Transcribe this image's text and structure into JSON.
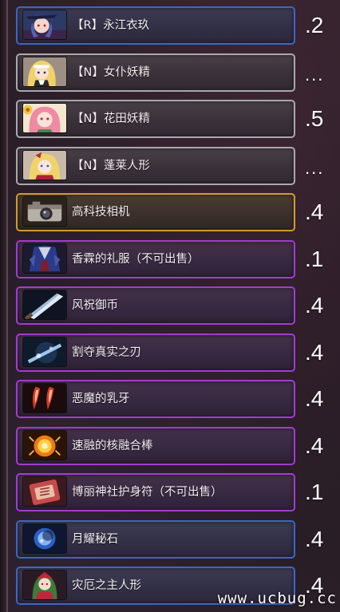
{
  "items": [
    {
      "label": "【R】永江衣玖",
      "value": ".2",
      "rarity": "blue",
      "icon": "character-portrait-icon"
    },
    {
      "label": "【N】女仆妖精",
      "value": "...",
      "rarity": "gray",
      "icon": "character-portrait-icon"
    },
    {
      "label": "【N】花田妖精",
      "value": ".5",
      "rarity": "gray",
      "icon": "character-portrait-icon"
    },
    {
      "label": "【N】蓬莱人形",
      "value": "...",
      "rarity": "gray",
      "icon": "character-portrait-icon"
    },
    {
      "label": "高科技相机",
      "value": ".4",
      "rarity": "gold",
      "icon": "camera-icon"
    },
    {
      "label": "香霖的礼服（不可出售）",
      "value": ".1",
      "rarity": "purple",
      "icon": "robe-icon"
    },
    {
      "label": "风祝御币",
      "value": ".4",
      "rarity": "purple",
      "icon": "blade-icon"
    },
    {
      "label": "割夺真实之刃",
      "value": ".4",
      "rarity": "purple",
      "icon": "sword-icon"
    },
    {
      "label": "恶魔的乳牙",
      "value": ".4",
      "rarity": "purple",
      "icon": "fang-icon"
    },
    {
      "label": "速融的核融合棒",
      "value": ".4",
      "rarity": "purple",
      "icon": "fusion-rod-icon"
    },
    {
      "label": "博丽神社护身符（不可出售）",
      "value": ".1",
      "rarity": "purple",
      "icon": "charm-icon"
    },
    {
      "label": "月耀秘石",
      "value": ".4",
      "rarity": "blue",
      "icon": "moon-stone-icon"
    },
    {
      "label": "灾厄之主人形",
      "value": ".4",
      "rarity": "blue",
      "icon": "doll-icon"
    }
  ],
  "watermark": "www.ucbug.cc",
  "colors": {
    "blue": "#3b66c8",
    "gray": "#a8a8b0",
    "gold": "#d69a2a",
    "purple": "#a33bd2"
  }
}
